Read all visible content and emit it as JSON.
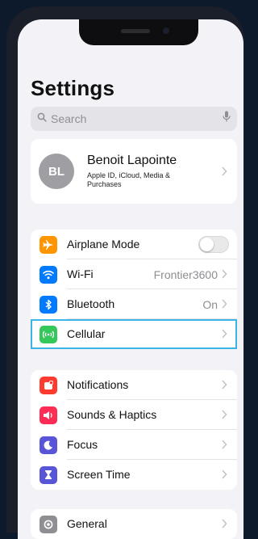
{
  "title": "Settings",
  "search": {
    "placeholder": "Search"
  },
  "profile": {
    "initials": "BL",
    "name": "Benoit Lapointe",
    "subtitle": "Apple ID, iCloud, Media & Purchases"
  },
  "group1": [
    {
      "id": "airplane",
      "label": "Airplane Mode",
      "icon": "airplane-icon",
      "color": "#ff9500",
      "toggle": false
    },
    {
      "id": "wifi",
      "label": "Wi-Fi",
      "value": "Frontier3600",
      "icon": "wifi-icon",
      "color": "#007aff"
    },
    {
      "id": "bluetooth",
      "label": "Bluetooth",
      "value": "On",
      "icon": "bluetooth-icon",
      "color": "#007aff"
    },
    {
      "id": "cellular",
      "label": "Cellular",
      "icon": "cellular-icon",
      "color": "#34c759",
      "highlighted": true
    }
  ],
  "group2": [
    {
      "id": "notifications",
      "label": "Notifications",
      "icon": "notifications-icon",
      "color": "#ff3b30"
    },
    {
      "id": "sounds",
      "label": "Sounds & Haptics",
      "icon": "speaker-icon",
      "color": "#ff2d55"
    },
    {
      "id": "focus",
      "label": "Focus",
      "icon": "moon-icon",
      "color": "#5856d6"
    },
    {
      "id": "screentime",
      "label": "Screen Time",
      "icon": "hourglass-icon",
      "color": "#5856d6"
    }
  ],
  "group3": [
    {
      "id": "general",
      "label": "General",
      "icon": "gear-icon",
      "color": "#8e8e93"
    }
  ],
  "colors": {
    "highlight": "#3bb4e6",
    "background": "#f2f2f7"
  }
}
